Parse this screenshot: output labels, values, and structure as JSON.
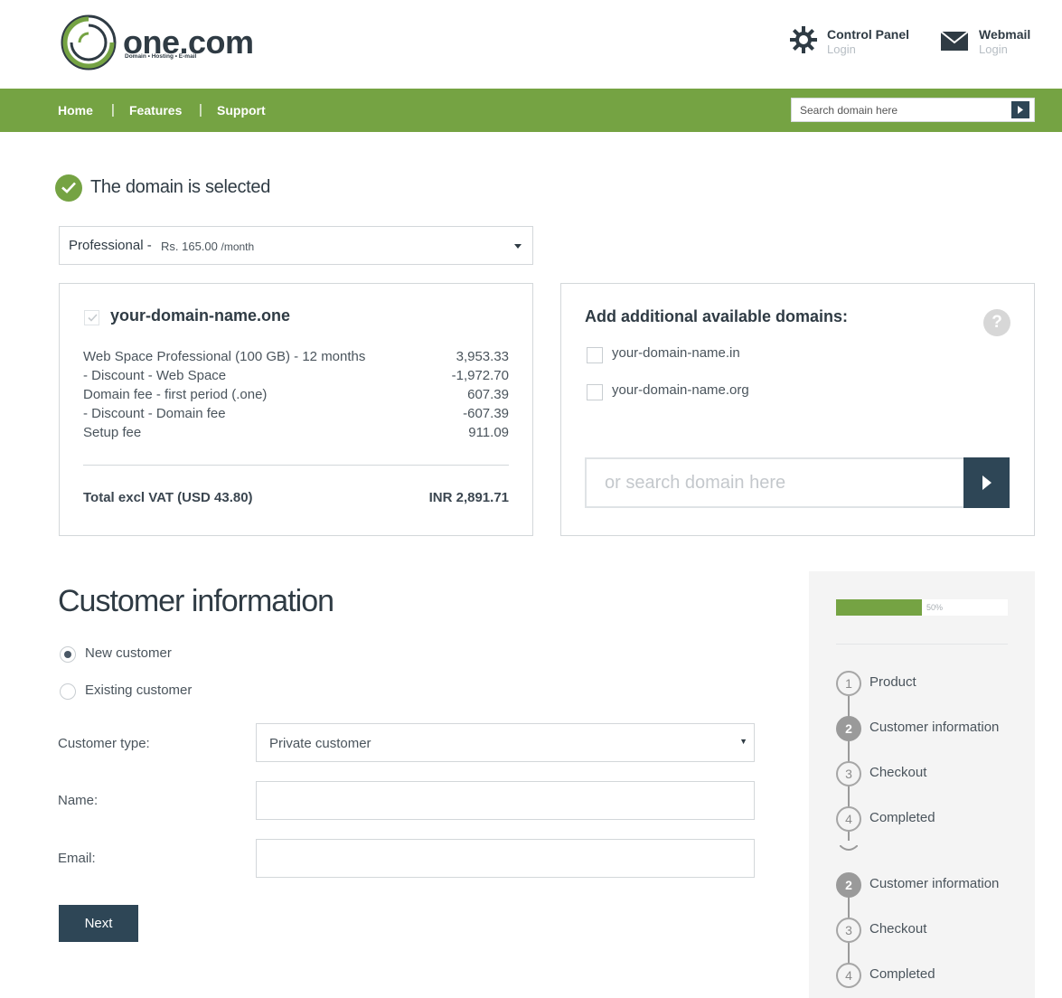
{
  "brand": {
    "name": "one.com",
    "tagline": "Domain • Hosting • E-mail",
    "accent": "#75a343",
    "dark": "#2e4656"
  },
  "header": {
    "control_panel": {
      "title": "Control Panel",
      "sub": "Login"
    },
    "webmail": {
      "title": "Webmail",
      "sub": "Login"
    }
  },
  "nav": {
    "items": [
      "Home",
      "Features",
      "Support"
    ],
    "separator": "|",
    "search_placeholder": "Search domain here"
  },
  "domain_selected": {
    "title": "The domain is selected"
  },
  "plan": {
    "name": "Professional",
    "dash": "-",
    "price": "Rs. 165.00",
    "period": "/month"
  },
  "summary": {
    "domain": "your-domain-name.one",
    "lines": [
      {
        "label": "Web Space Professional (100 GB) - 12 months",
        "value": "3,953.33"
      },
      {
        "label": "- Discount - Web Space",
        "value": "-1,972.70"
      },
      {
        "label": "Domain fee - first period (.one)",
        "value": "607.39"
      },
      {
        "label": "- Discount - Domain fee",
        "value": "-607.39"
      },
      {
        "label": "Setup fee",
        "value": "911.09"
      }
    ],
    "total_label": "Total excl VAT (USD 43.80)",
    "total_value": "INR 2,891.71"
  },
  "additional": {
    "title": "Add additional available domains:",
    "help": "?",
    "domains": [
      "your-domain-name.in",
      "your-domain-name.org"
    ],
    "search_placeholder": "or search domain here"
  },
  "customer": {
    "title": "Customer information",
    "options": [
      "New customer",
      "Existing customer"
    ],
    "selected_option": "New customer",
    "type_label": "Customer type:",
    "type_value": "Private customer",
    "name_label": "Name:",
    "name_value": "",
    "email_label": "Email:",
    "email_value": "",
    "next_label": "Next"
  },
  "progress": {
    "percent": 50,
    "percent_label": "50%",
    "steps_a": [
      {
        "num": "1",
        "label": "Product"
      },
      {
        "num": "2",
        "label": "Customer information"
      },
      {
        "num": "3",
        "label": "Checkout"
      },
      {
        "num": "4",
        "label": "Completed"
      }
    ],
    "steps_b": [
      {
        "num": "2",
        "label": "Customer information"
      },
      {
        "num": "3",
        "label": "Checkout"
      },
      {
        "num": "4",
        "label": "Completed"
      }
    ],
    "active_num": "2"
  }
}
